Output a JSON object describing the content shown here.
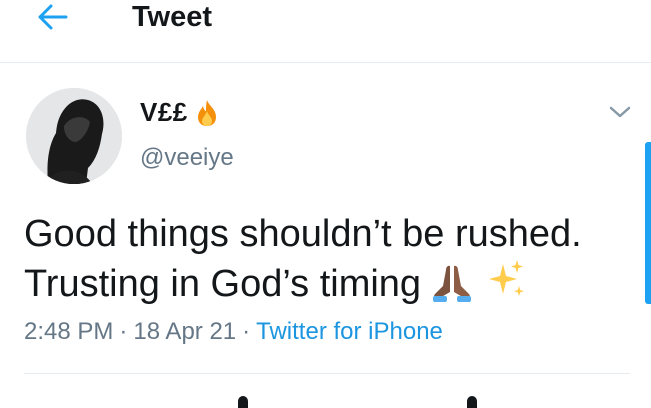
{
  "header": {
    "title": "Tweet",
    "back_icon": "arrow-left-icon"
  },
  "colors": {
    "accent": "#1da1f2",
    "link": "#1b95e0",
    "secondary_text": "#657786",
    "divider": "#e6ecf0"
  },
  "tweet": {
    "author": {
      "display_name": "V££",
      "name_emoji": "fire-emoji",
      "username": "@veeiye",
      "avatar": "avatar-photo"
    },
    "text_lines": [
      "Good things shouldn’t be rushed.",
      "Trusting in God’s timing"
    ],
    "text_emojis": [
      "folded-hands-emoji",
      "sparkles-emoji"
    ],
    "time": "2:48 PM",
    "date": "18 Apr 21",
    "source": "Twitter for iPhone",
    "menu_icon": "chevron-down-icon"
  }
}
